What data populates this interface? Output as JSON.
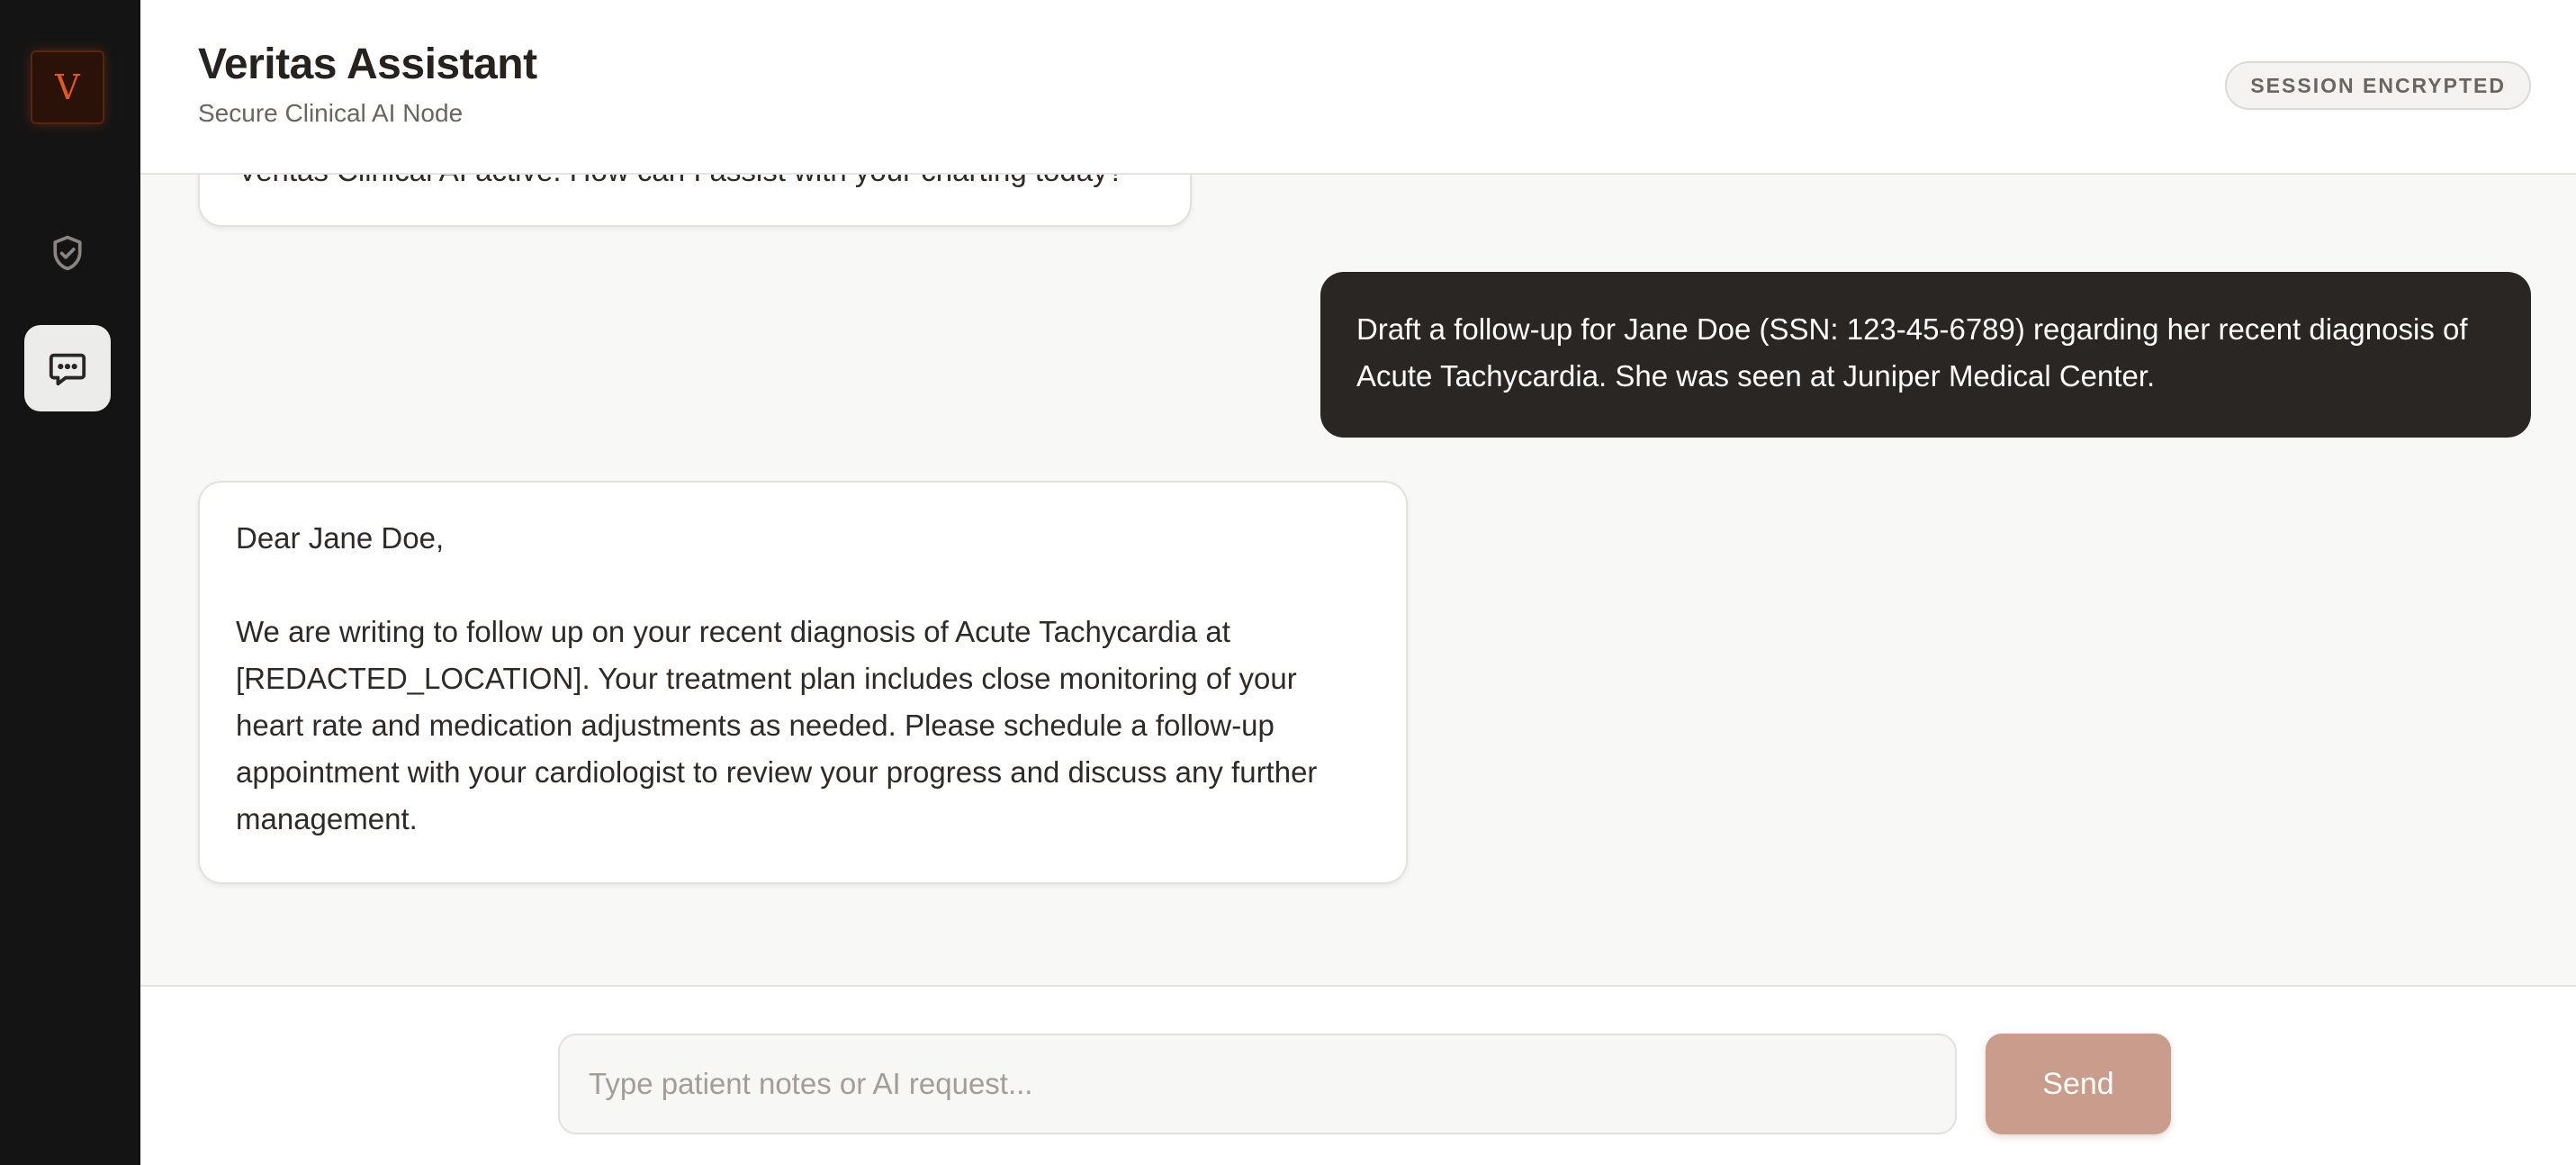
{
  "sidebar": {
    "logo_letter": "V",
    "nav": [
      {
        "icon": "shield-check-icon"
      },
      {
        "icon": "chat-bubble-icon",
        "active": true
      }
    ]
  },
  "header": {
    "title": "Veritas Assistant",
    "subtitle": "Secure Clinical AI Node",
    "badge": "SESSION ENCRYPTED"
  },
  "messages": [
    {
      "role": "assistant",
      "text": "Veritas Clinical AI active. How can I assist with your charting today?"
    },
    {
      "role": "user",
      "text": "Draft a follow-up for Jane Doe (SSN: 123-45-6789) regarding her recent diagnosis of Acute Tachycardia. She was seen at Juniper Medical Center."
    },
    {
      "role": "assistant",
      "greeting": "Dear Jane Doe,",
      "body": "We are writing to follow up on your recent diagnosis of Acute Tachycardia at [REDACTED_LOCATION]. Your treatment plan includes close monitoring of your heart rate and medication adjustments as needed. Please schedule a follow-up appointment with your cardiologist to review your progress and discuss any further management."
    }
  ],
  "composer": {
    "placeholder": "Type patient notes or AI request...",
    "value": "",
    "send_label": "Send"
  },
  "colors": {
    "accent": "#e35a18",
    "send_button": "#c99c8c",
    "user_bubble": "#2a2624",
    "sidebar": "#141414"
  }
}
